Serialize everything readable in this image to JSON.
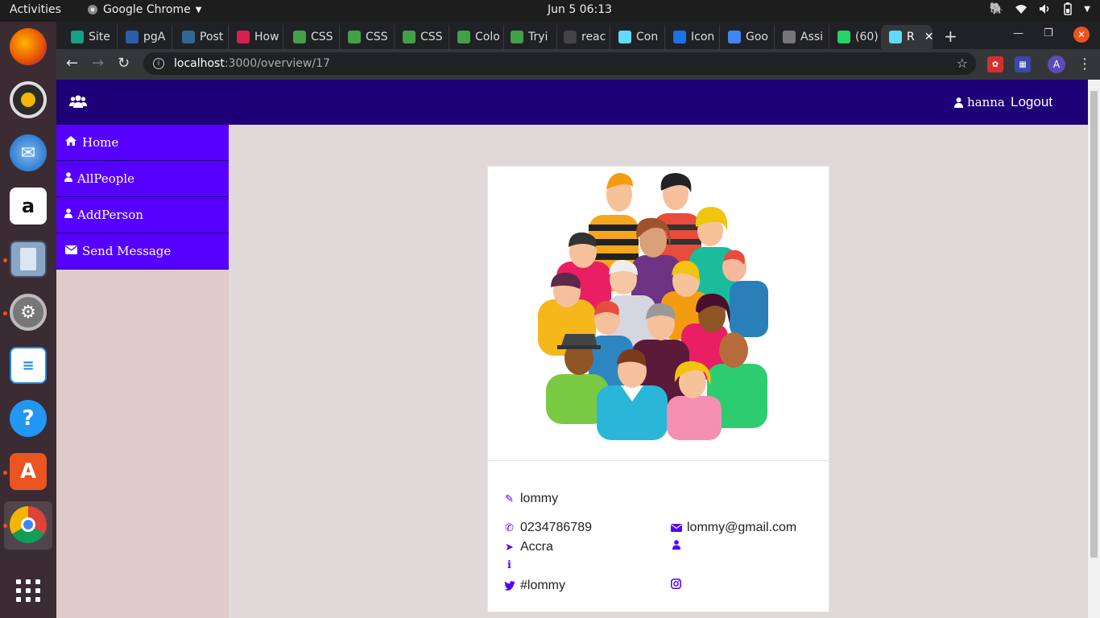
{
  "topbar": {
    "activities": "Activities",
    "app_name": "Google Chrome",
    "clock": "Jun 5  06:13"
  },
  "dock": {
    "items": [
      "firefox-icon",
      "rhythmbox-icon",
      "thunderbird-icon",
      "amazon-icon",
      "files-icon",
      "settings-icon",
      "writer-icon",
      "help-icon",
      "software-icon",
      "chrome-icon",
      "show-apps-icon"
    ]
  },
  "browser": {
    "tabs": [
      {
        "label": "Site",
        "color": "#16a085"
      },
      {
        "label": "pgA",
        "color": "#2b5fa8"
      },
      {
        "label": "Post",
        "color": "#336791"
      },
      {
        "label": "How",
        "color": "#d6204f"
      },
      {
        "label": "CSS",
        "color": "#43a047"
      },
      {
        "label": "CSS",
        "color": "#43a047"
      },
      {
        "label": "CSS",
        "color": "#43a047"
      },
      {
        "label": "Colo",
        "color": "#43a047"
      },
      {
        "label": "Tryi",
        "color": "#43a047"
      },
      {
        "label": "reac",
        "color": "#444444"
      },
      {
        "label": "Con",
        "color": "#61dafb"
      },
      {
        "label": "Icon",
        "color": "#1a73e8"
      },
      {
        "label": "Goo",
        "color": "#4285f4"
      },
      {
        "label": "Assi",
        "color": "#777777"
      },
      {
        "label": "(60)",
        "color": "#25d366"
      },
      {
        "label": "R",
        "color": "#61dafb"
      }
    ],
    "url_host": "localhost",
    "url_path": ":3000/overview/17"
  },
  "app": {
    "header": {
      "username": "hanna",
      "logout_label": "Logout"
    },
    "sidebar": {
      "items": [
        {
          "label": "Home",
          "icon": "home-icon"
        },
        {
          "label": "AllPeople",
          "icon": "user-icon"
        },
        {
          "label": "AddPerson",
          "icon": "user-icon"
        },
        {
          "label": "Send Message",
          "icon": "envelope-icon"
        }
      ]
    },
    "profile": {
      "name": "lommy",
      "phone": "0234786789",
      "email": "lommy@gmail.com",
      "location": "Accra",
      "twitter": "#lommy"
    }
  },
  "colors": {
    "header_bg": "#1e0078",
    "sidebar_item_bg": "#5600ff",
    "accent": "#5600ff",
    "page_bg": "#e0d8d9"
  }
}
